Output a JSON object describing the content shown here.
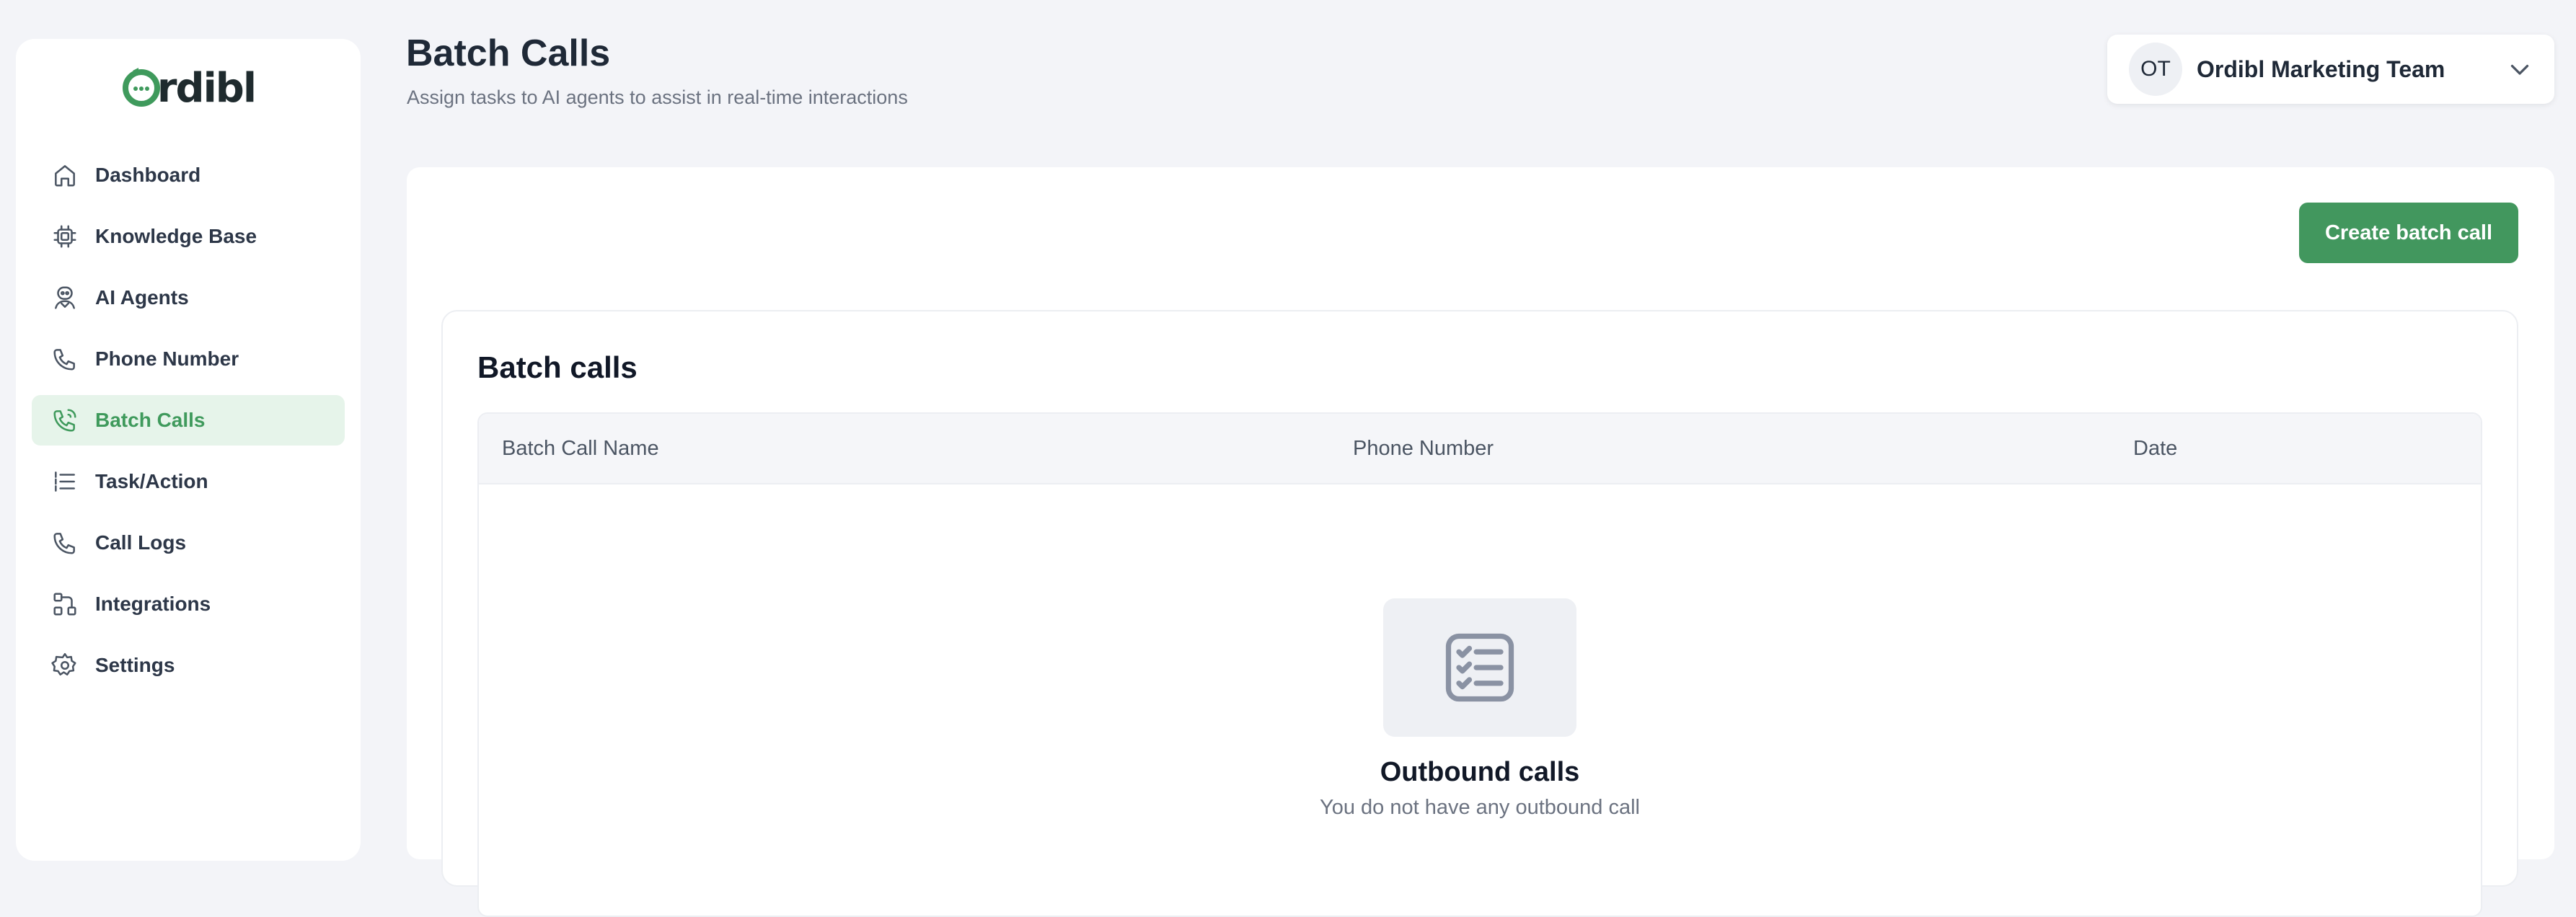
{
  "app": {
    "logo_text": "rdibl",
    "brand_color": "#42975e"
  },
  "sidebar": {
    "items": [
      {
        "label": "Dashboard",
        "icon": "home-icon",
        "active": false
      },
      {
        "label": "Knowledge Base",
        "icon": "chip-icon",
        "active": false
      },
      {
        "label": "AI Agents",
        "icon": "agent-icon",
        "active": false
      },
      {
        "label": "Phone Number",
        "icon": "phone-icon",
        "active": false
      },
      {
        "label": "Batch Calls",
        "icon": "phone-ringing-icon",
        "active": true
      },
      {
        "label": "Task/Action",
        "icon": "checklist-icon",
        "active": false
      },
      {
        "label": "Call Logs",
        "icon": "phone-icon",
        "active": false
      },
      {
        "label": "Integrations",
        "icon": "integrations-icon",
        "active": false
      },
      {
        "label": "Settings",
        "icon": "gear-icon",
        "active": false
      }
    ]
  },
  "header": {
    "title": "Batch Calls",
    "subtitle": "Assign tasks to AI agents to assist in real-time interactions"
  },
  "team_selector": {
    "initials": "OT",
    "name": "Ordibl Marketing Team"
  },
  "main": {
    "create_button_label": "Create batch call",
    "card_title": "Batch calls",
    "table": {
      "columns": [
        "Batch Call Name",
        "Phone Number",
        "Date"
      ],
      "rows": []
    },
    "empty_state": {
      "title": "Outbound calls",
      "subtitle": "You do not have any outbound call"
    }
  }
}
